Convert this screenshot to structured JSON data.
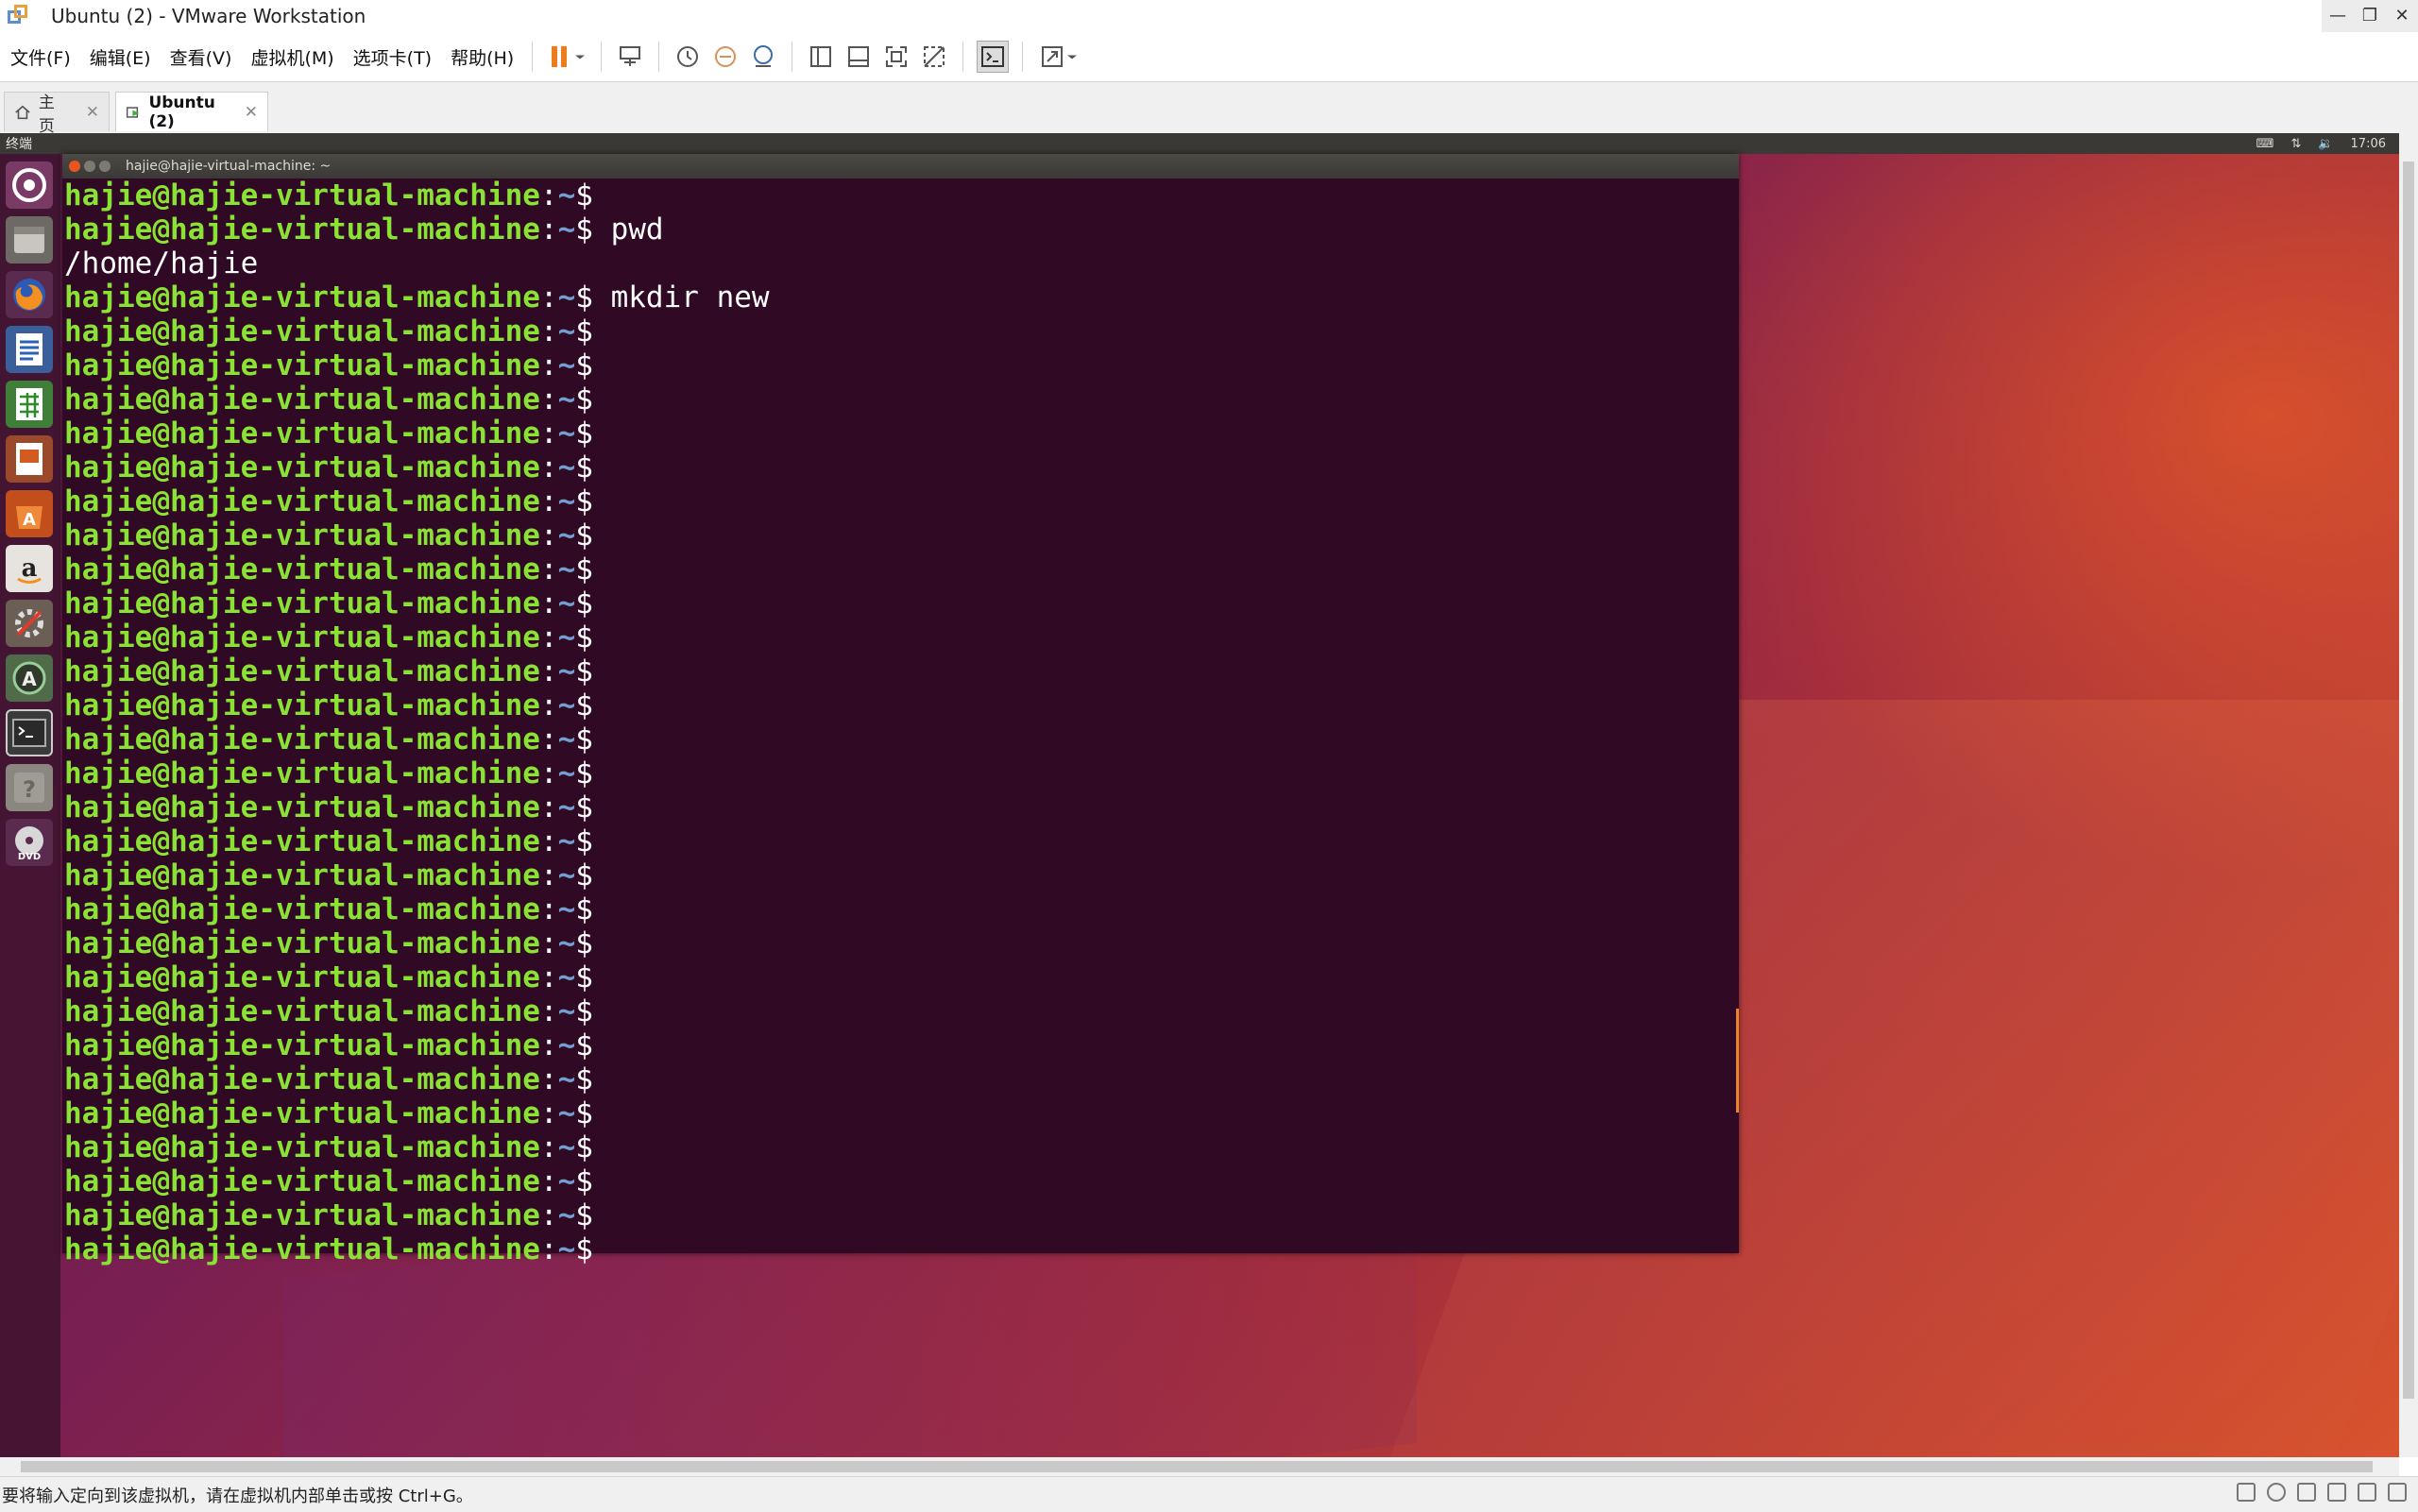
{
  "window": {
    "title": "Ubuntu (2) - VMware Workstation",
    "controls": [
      "—",
      "❐",
      "✕"
    ]
  },
  "menubar": {
    "items": [
      "文件(F)",
      "编辑(E)",
      "查看(V)",
      "虚拟机(M)",
      "选项卡(T)",
      "帮助(H)"
    ]
  },
  "tabs": [
    {
      "label": "主页",
      "close": "✕"
    },
    {
      "label": "Ubuntu (2)",
      "close": "✕"
    }
  ],
  "guest": {
    "panel_label": "终端",
    "clock": "17:06",
    "launcher_items": [
      "ubuntu-dash-icon",
      "files-icon",
      "firefox-icon",
      "writer-icon",
      "calc-icon",
      "impress-icon",
      "software-center-icon",
      "amazon-icon",
      "system-settings-icon",
      "software-updater-icon",
      "terminal-icon",
      "help-icon",
      "dvd-icon"
    ]
  },
  "terminal": {
    "title": "hajie@hajie-virtual-machine: ~",
    "prompt_user_host": "hajie@hajie-virtual-machine",
    "prompt_colon": ":",
    "prompt_path": "~",
    "prompt_dollar": "$",
    "lines": [
      {
        "type": "prompt",
        "cmd": ""
      },
      {
        "type": "prompt",
        "cmd": " pwd"
      },
      {
        "type": "output",
        "text": "/home/hajie"
      },
      {
        "type": "prompt",
        "cmd": " mkdir new"
      },
      {
        "type": "prompt",
        "cmd": ""
      },
      {
        "type": "prompt",
        "cmd": ""
      },
      {
        "type": "prompt",
        "cmd": ""
      },
      {
        "type": "prompt",
        "cmd": ""
      },
      {
        "type": "prompt",
        "cmd": ""
      },
      {
        "type": "prompt",
        "cmd": ""
      },
      {
        "type": "prompt",
        "cmd": ""
      },
      {
        "type": "prompt",
        "cmd": ""
      },
      {
        "type": "prompt",
        "cmd": ""
      },
      {
        "type": "prompt",
        "cmd": ""
      },
      {
        "type": "prompt",
        "cmd": ""
      },
      {
        "type": "prompt",
        "cmd": ""
      },
      {
        "type": "prompt",
        "cmd": ""
      },
      {
        "type": "prompt",
        "cmd": ""
      },
      {
        "type": "prompt",
        "cmd": ""
      },
      {
        "type": "prompt",
        "cmd": ""
      },
      {
        "type": "prompt",
        "cmd": ""
      },
      {
        "type": "prompt",
        "cmd": ""
      },
      {
        "type": "prompt",
        "cmd": ""
      },
      {
        "type": "prompt",
        "cmd": ""
      },
      {
        "type": "prompt",
        "cmd": ""
      },
      {
        "type": "prompt",
        "cmd": ""
      },
      {
        "type": "prompt",
        "cmd": ""
      },
      {
        "type": "prompt",
        "cmd": ""
      },
      {
        "type": "prompt",
        "cmd": ""
      },
      {
        "type": "prompt",
        "cmd": ""
      },
      {
        "type": "prompt",
        "cmd": ""
      },
      {
        "type": "prompt",
        "cmd": ""
      }
    ]
  },
  "statusbar": {
    "text": "要将输入定向到该虚拟机，请在虚拟机内部单击或按 Ctrl+G。"
  },
  "colors": {
    "terminal_bg": "#300a24",
    "prompt_green": "#8ae234",
    "prompt_blue": "#729fcf",
    "pause_orange": "#f07b1a"
  }
}
